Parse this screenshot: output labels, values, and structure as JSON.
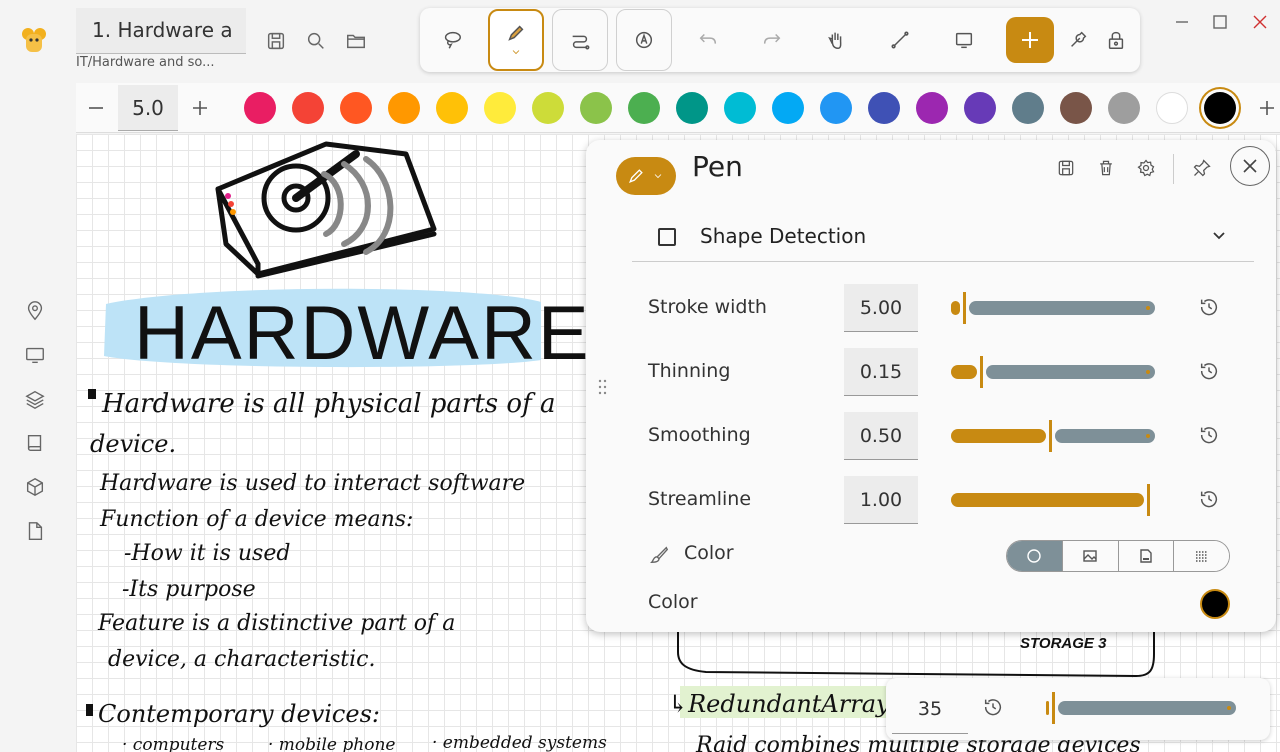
{
  "window": {
    "doc_title": "1. Hardware a",
    "doc_path": "IT/Hardware and so...",
    "controls": [
      "minimize",
      "maximize",
      "close"
    ]
  },
  "toolbar": {
    "tools": [
      {
        "name": "lasso",
        "icon": "lasso-icon"
      },
      {
        "name": "pen",
        "icon": "pen-icon",
        "active": true
      },
      {
        "name": "shapes",
        "icon": "shape-path-icon"
      },
      {
        "name": "text",
        "icon": "text-icon"
      },
      {
        "name": "undo",
        "icon": "undo-icon",
        "disabled": true
      },
      {
        "name": "redo",
        "icon": "redo-icon",
        "disabled": true
      },
      {
        "name": "pan",
        "icon": "hand-icon"
      },
      {
        "name": "line",
        "icon": "line-icon"
      },
      {
        "name": "present",
        "icon": "screen-icon"
      },
      {
        "name": "add",
        "icon": "plus-icon"
      },
      {
        "name": "settings",
        "icon": "wrench-icon"
      },
      {
        "name": "lock",
        "icon": "lock-icon"
      }
    ]
  },
  "colorbar": {
    "size_value": "5.0",
    "accent": "#c88a12",
    "swatches": [
      "#e91e63",
      "#f44336",
      "#ff5722",
      "#ff9800",
      "#ffc107",
      "#ffeb3b",
      "#cddc39",
      "#8bc34a",
      "#4caf50",
      "#009688",
      "#00bcd4",
      "#03a9f4",
      "#2196f3",
      "#3f51b5",
      "#9c27b0",
      "#673ab7",
      "#607d8b",
      "#795548",
      "#9e9e9e",
      "#ffffff",
      "#000000"
    ],
    "selected_index": 20
  },
  "sidebar": {
    "items": [
      "location-pin-icon",
      "monitor-icon",
      "layers-icon",
      "book-icon",
      "cube-icon",
      "file-icon"
    ]
  },
  "pen_panel": {
    "title": "Pen",
    "shape_detection_label": "Shape Detection",
    "shape_detection_checked": false,
    "settings": [
      {
        "label": "Stroke width",
        "value": "5.00",
        "fraction": 0.06
      },
      {
        "label": "Thinning",
        "value": "0.15",
        "fraction": 0.15
      },
      {
        "label": "Smoothing",
        "value": "0.50",
        "fraction": 0.5
      },
      {
        "label": "Streamline",
        "value": "1.00",
        "fraction": 1.0
      }
    ],
    "color_label": "Color",
    "color_label_2": "Color",
    "color_value": "#000000",
    "color_modes": [
      "solid-circle-icon",
      "image-icon",
      "svg-icon",
      "pattern-icon"
    ]
  },
  "mini_panel": {
    "value": "35",
    "fraction": 0.02
  },
  "sketch": {
    "heading": "HARDWARE",
    "notes": [
      "Hardware is all physical parts of a",
      "device.",
      "Hardware is used to interact software",
      "Function of a device means:",
      "-How it is used",
      "-Its purpose",
      "Feature is a distinctive part of a",
      "device, a characteristic.",
      "Contemporary devices:",
      "· computers",
      "· mobile phone",
      "· embedded systems"
    ],
    "storage_label": "STORAGE 3",
    "redundant_text": "↳RedundantArrayof",
    "raid_text": "Raid combines multiple storage devices"
  }
}
